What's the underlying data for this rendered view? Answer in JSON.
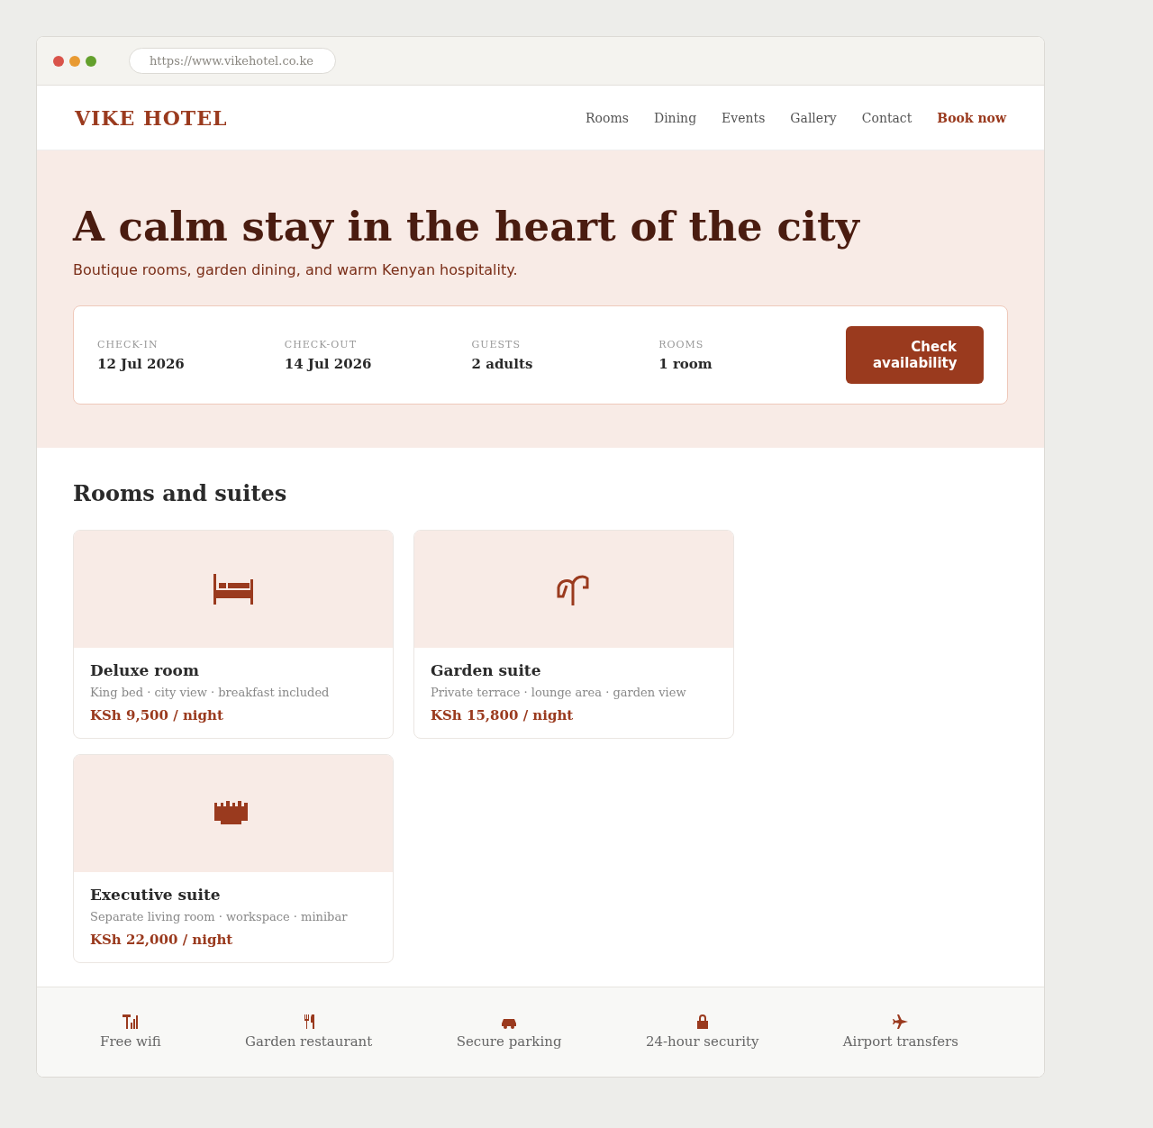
{
  "browser": {
    "url": "https://www.vikehotel.co.ke"
  },
  "nav": {
    "logo": "VIKE HOTEL",
    "links": [
      {
        "label": "Rooms",
        "kind": "link"
      },
      {
        "label": "Dining",
        "kind": "link"
      },
      {
        "label": "Events",
        "kind": "link"
      },
      {
        "label": "Gallery",
        "kind": "link"
      },
      {
        "label": "Contact",
        "kind": "link"
      },
      {
        "label": "Book now",
        "kind": "cta"
      }
    ]
  },
  "hero": {
    "title": "A calm stay in the heart of the city",
    "subtitle": "Boutique rooms, garden dining, and warm Kenyan hospitality."
  },
  "booking": {
    "fields": [
      {
        "label": "CHECK-IN",
        "value": "12 Jul 2026"
      },
      {
        "label": "CHECK-OUT",
        "value": "14 Jul 2026"
      },
      {
        "label": "GUESTS",
        "value": "2 adults"
      },
      {
        "label": "ROOMS",
        "value": "1 room"
      }
    ],
    "button": "Check availability"
  },
  "rooms": {
    "heading": "Rooms and suites",
    "items": [
      {
        "name": "Deluxe room",
        "details": "King bed · city view · breakfast included",
        "price": "KSh 9,500 / night"
      },
      {
        "name": "Garden suite",
        "details": "Private terrace · lounge area · garden view",
        "price": "KSh 15,800 / night"
      },
      {
        "name": "Executive suite",
        "details": "Separate living room · workspace · minibar",
        "price": "KSh 22,000 / night"
      }
    ]
  },
  "amenities": [
    {
      "label": "Free wifi"
    },
    {
      "label": "Garden restaurant"
    },
    {
      "label": "Secure parking"
    },
    {
      "label": "24-hour security"
    },
    {
      "label": "Airport transfers"
    }
  ]
}
